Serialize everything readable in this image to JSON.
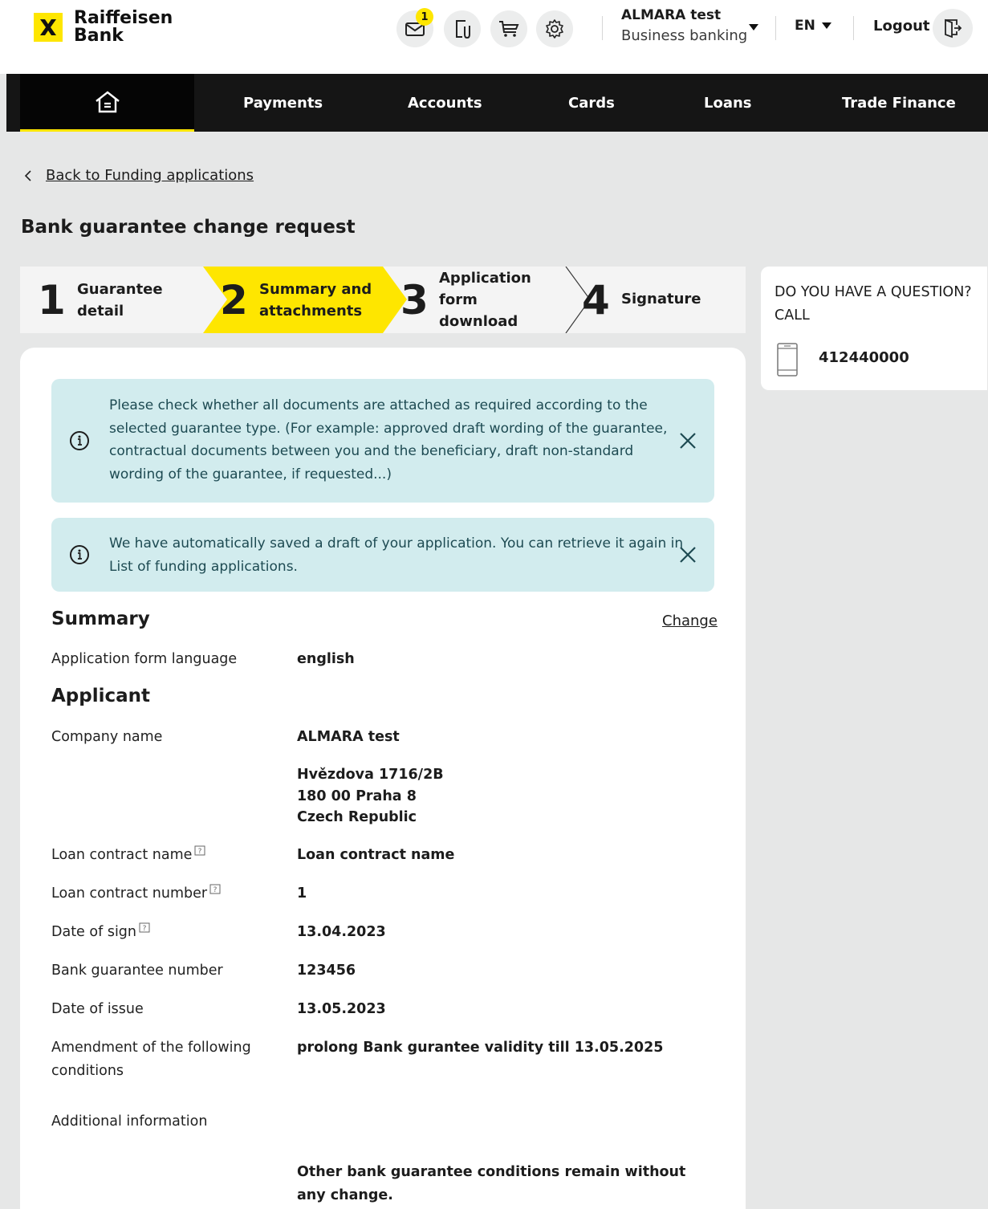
{
  "brand": {
    "line1": "Raiffeisen",
    "line2": "Bank"
  },
  "header": {
    "messages_badge": "1",
    "user_name": "ALMARA test",
    "user_segment": "Business banking",
    "language": "EN",
    "logout_label": "Logout"
  },
  "nav": {
    "items": [
      {
        "label": "Payments"
      },
      {
        "label": "Accounts"
      },
      {
        "label": "Cards"
      },
      {
        "label": "Loans"
      },
      {
        "label": "Trade Finance"
      }
    ]
  },
  "back_link": "Back to Funding applications",
  "page_title": "Bank guarantee change request",
  "steps": [
    {
      "num": "1",
      "label": "Guarantee detail",
      "active": false
    },
    {
      "num": "2",
      "label": "Summary and attachments",
      "active": true
    },
    {
      "num": "3",
      "label": "Application form download",
      "active": false
    },
    {
      "num": "4",
      "label": "Signature",
      "active": false
    }
  ],
  "alerts": [
    {
      "text": "Please check whether all documents are attached as required according to the selected guarantee type. (For example: approved draft wording of the guarantee, contractual documents between you and the beneficiary, draft non-standard wording of the guarantee, if requested...)"
    },
    {
      "text": "We have automatically saved a draft of your application. You can retrieve it again in  List of funding applications."
    }
  ],
  "summary": {
    "title": "Summary",
    "change_label": "Change",
    "form_language_label": "Application form language",
    "form_language_value": "english"
  },
  "applicant": {
    "title": "Applicant",
    "company_label": "Company name",
    "company_value": "ALMARA test",
    "address_line1": "Hvězdova 1716/2B",
    "address_line2": "180 00  Praha 8",
    "address_line3": "Czech Republic",
    "loan_name_label": "Loan contract name",
    "loan_name_value": "Loan contract name",
    "loan_number_label": "Loan contract number",
    "loan_number_value": "1",
    "date_sign_label": "Date of sign",
    "date_sign_value": "13.04.2023",
    "guarantee_number_label": "Bank guarantee number",
    "guarantee_number_value": "123456",
    "date_issue_label": "Date of issue",
    "date_issue_value": "13.05.2023",
    "amendment_label": "Amendment of the following conditions",
    "amendment_value": "prolong Bank gurantee validity till  13.05.2025",
    "additional_label": "Additional information",
    "additional_value": "Other bank guarantee conditions remain without any change."
  },
  "side_panel": {
    "question": "DO YOU HAVE A QUESTION? CALL",
    "phone": "412440000"
  },
  "colors": {
    "brand_yellow": "#fee600",
    "nav_dark": "#151515",
    "alert_bg": "#d2ecee",
    "alert_text": "#1d4a52",
    "page_bg": "#e6e7e7"
  }
}
